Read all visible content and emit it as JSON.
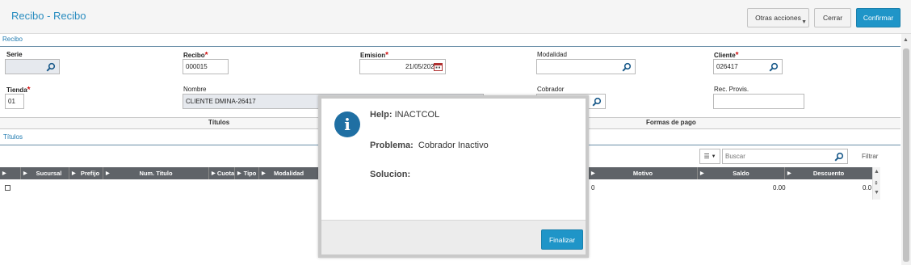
{
  "header": {
    "title": "Recibo - Recibo",
    "actions": {
      "otras": "Otras acciones",
      "cerrar": "Cerrar",
      "confirmar": "Confirmar"
    }
  },
  "form": {
    "section_label": "Recibo",
    "serie": {
      "label": "Serie",
      "value": ""
    },
    "recibo": {
      "label": "Recibo",
      "required": "*",
      "value": "000015"
    },
    "emision": {
      "label": "Emision",
      "required": "*",
      "value": "21/05/2025"
    },
    "modalidad": {
      "label": "Modalidad",
      "value": ""
    },
    "cliente": {
      "label": "Cliente",
      "required": "*",
      "value": "026417"
    },
    "tienda": {
      "label": "Tienda",
      "required": "*",
      "value": "01"
    },
    "nombre": {
      "label": "Nombre",
      "value": "CLIENTE DMINA-26417"
    },
    "cobrador": {
      "label": "Cobrador",
      "value": ""
    },
    "rec_provis": {
      "label": "Rec. Provis.",
      "value": ""
    }
  },
  "tabs": {
    "titulos": "Títulos",
    "formas_pago": "Formas de pago"
  },
  "titulos": {
    "section_label": "Títulos",
    "search_placeholder": "Buscar",
    "filter_label": "Filtrar",
    "columns_icon": "columns-icon",
    "columns": [
      "Sucursal",
      "Prefijo",
      "Num. Titulo",
      "Cuota",
      "Tipo",
      "Modalidad",
      "Motivo",
      "Saldo",
      "Descuento"
    ],
    "row": {
      "motivo_partial": "0",
      "saldo": "0.00",
      "descuento_partial": "0.0"
    }
  },
  "modal": {
    "help_label": "Help:",
    "help_value": "INACTCOL",
    "problema_label": "Problema:",
    "problema_value": "Cobrador Inactivo",
    "solucion_label": "Solucion:",
    "solucion_value": "",
    "button": "Finalizar",
    "icon": "info-icon"
  },
  "colors": {
    "accent": "#1f95c8",
    "title": "#2a8dc0",
    "grid_header": "#5f6368",
    "required": "#d01010"
  }
}
